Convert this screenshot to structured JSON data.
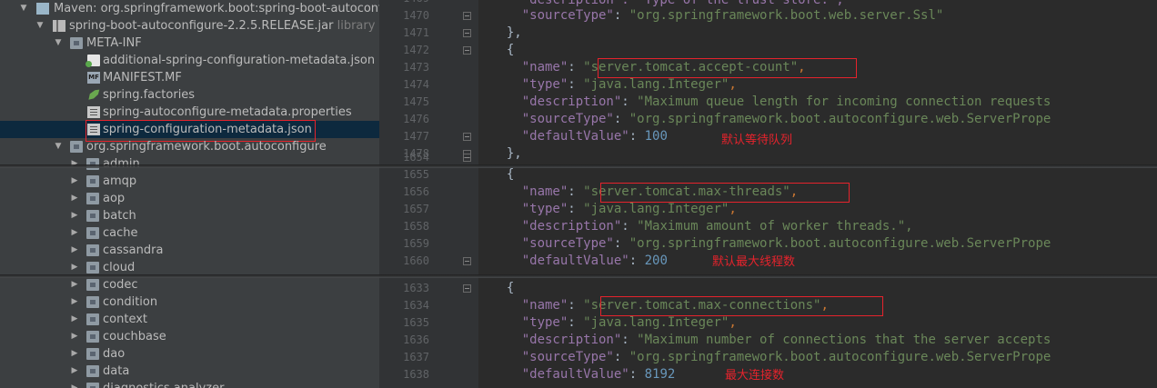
{
  "tree": {
    "root_label": "Maven: org.springframework.boot:spring-boot-autoconfig",
    "jar_label": "spring-boot-autoconfigure-2.2.5.RELEASE.jar",
    "jar_hint": "library ro",
    "meta_inf": "META-INF",
    "files": [
      "additional-spring-configuration-metadata.json",
      "MANIFEST.MF",
      "spring.factories",
      "spring-autoconfigure-metadata.properties",
      "spring-configuration-metadata.json"
    ],
    "package": "org.springframework.boot.autoconfigure",
    "subpackages": [
      "admin",
      "amqp",
      "aop",
      "batch",
      "cache",
      "cassandra",
      "cloud",
      "codec",
      "condition",
      "context",
      "couchbase",
      "dao",
      "data",
      "diagnostics.analyzer"
    ],
    "mf_icon_text": "MF"
  },
  "editor": {
    "s1": {
      "lines": [
        "1469",
        "1470",
        "1471",
        "1472",
        "1473",
        "1474",
        "1475",
        "1476",
        "1477",
        "1478"
      ],
      "prev_description": "\"description\": \"Type of the trust store.\",",
      "prev_sourcetype_key": "\"sourceType\"",
      "prev_sourcetype_val": "\"org.springframework.boot.web.server.Ssl\"",
      "name_val": "\"server.tomcat.accept-count\"",
      "type_val": "\"java.lang.Integer\"",
      "desc_val": "\"Maximum queue length for incoming connection requests",
      "source_val": "\"org.springframework.boot.autoconfigure.web.ServerPrope",
      "default_val": "100",
      "note": "默认等待队列"
    },
    "s2": {
      "lines": [
        "1654",
        "1655",
        "1656",
        "1657",
        "1658",
        "1659",
        "1660"
      ],
      "name_val": "\"server.tomcat.max-threads\"",
      "type_val": "\"java.lang.Integer\"",
      "desc_val": "\"Maximum amount of worker threads.\",",
      "source_val": "\"org.springframework.boot.autoconfigure.web.ServerPrope",
      "default_val": "200",
      "note": "默认最大线程数"
    },
    "s3": {
      "lines": [
        "1633",
        "1634",
        "1635",
        "1636",
        "1637",
        "1638"
      ],
      "name_val": "\"server.tomcat.max-connections\"",
      "type_val": "\"java.lang.Integer\"",
      "desc_val": "\"Maximum number of connections that the server accepts",
      "source_val": "\"org.springframework.boot.autoconfigure.web.ServerPrope",
      "default_val": "8192",
      "note": "最大连接数"
    },
    "keys": {
      "name": "\"name\"",
      "type": "\"type\"",
      "description": "\"description\"",
      "sourceType": "\"sourceType\"",
      "defaultValue": "\"defaultValue\""
    },
    "punct": {
      "open": "{",
      "close_comma": "},",
      "colon": ": ",
      "comma": ","
    }
  },
  "colors": {
    "key": "#9876aa",
    "string": "#6a8759",
    "number": "#6897bb",
    "punct": "#cc7832",
    "annotation": "#e5232c",
    "selection": "#0d293e"
  }
}
